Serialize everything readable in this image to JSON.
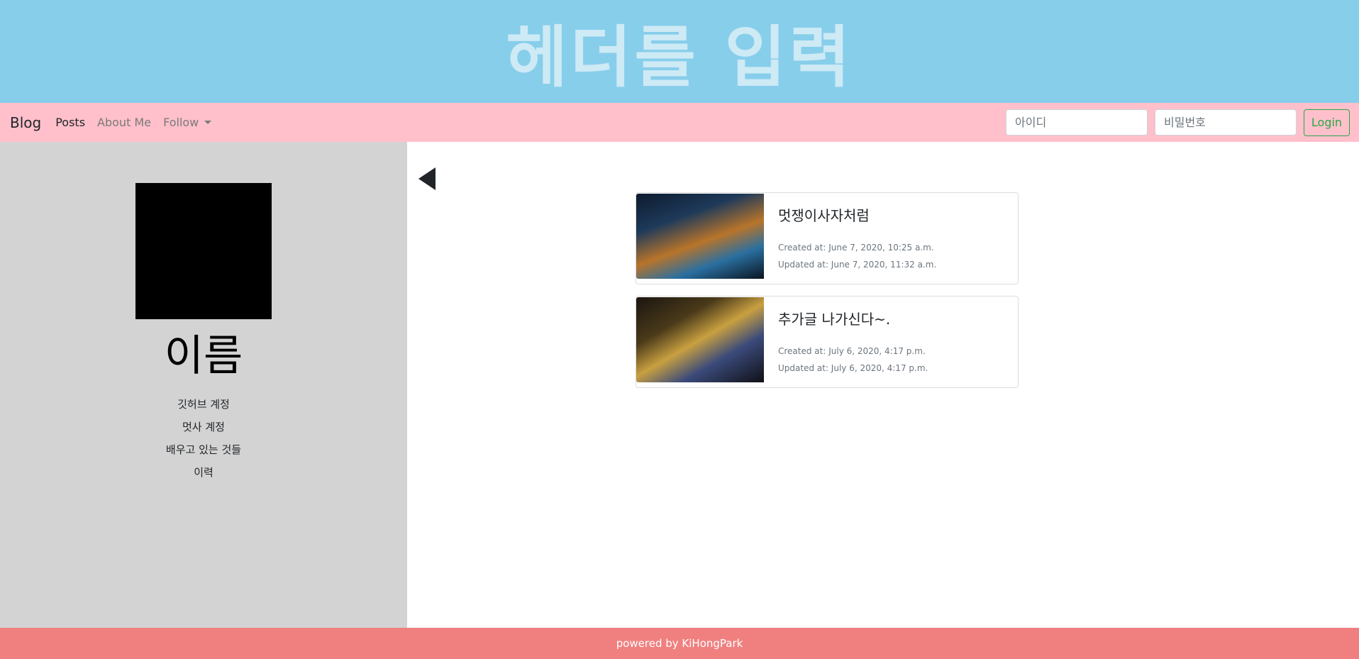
{
  "header": {
    "title": "헤더를 입력"
  },
  "navbar": {
    "brand": "Blog",
    "links": [
      {
        "label": "Posts"
      },
      {
        "label": "About Me"
      },
      {
        "label": "Follow"
      }
    ],
    "username_placeholder": "아이디",
    "password_placeholder": "비밀번호",
    "login_label": "Login"
  },
  "sidebar": {
    "name": "이름",
    "links": [
      "깃허브 계정",
      "멋사 계정",
      "배우고 있는 것들",
      "이력"
    ]
  },
  "posts": [
    {
      "title": "멋쟁이사자처럼",
      "created": "Created at: June 7, 2020, 10:25 a.m.",
      "updated": "Updated at: June 7, 2020, 11:32 a.m."
    },
    {
      "title": "추가글 나가신다~.",
      "created": "Created at: July 6, 2020, 4:17 p.m.",
      "updated": "Updated at: July 6, 2020, 4:17 p.m."
    }
  ],
  "footer": {
    "text": "powered by KiHongPark"
  }
}
